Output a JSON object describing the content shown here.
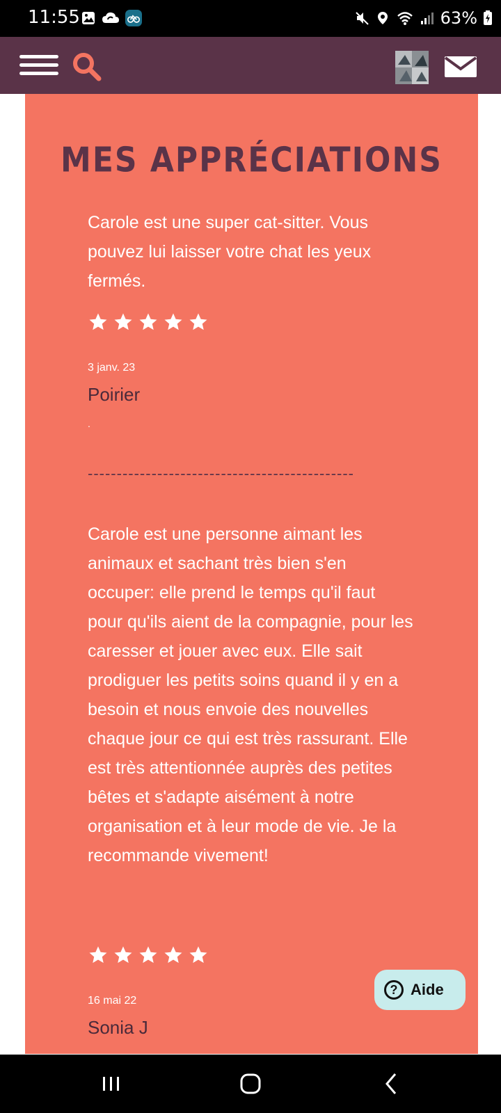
{
  "status_bar": {
    "time": "11:55",
    "battery": "63%",
    "icons": [
      "image-icon",
      "cloud-sync-icon",
      "bike-app-icon",
      "mute-icon",
      "location-icon",
      "wifi-icon",
      "signal-icon",
      "battery-icon"
    ]
  },
  "header": {
    "icons": [
      "menu-icon",
      "search-icon",
      "avatar",
      "mail-icon"
    ],
    "colors": {
      "background": "#5a3348",
      "search": "#f47461"
    }
  },
  "page": {
    "title": "MES APPRÉCIATIONS",
    "colors": {
      "panel": "#f47461",
      "title": "#5a3348"
    }
  },
  "reviews": [
    {
      "text": "Carole est une super cat-sitter. Vous pouvez lui laisser votre chat les yeux fermés.",
      "rating": 5,
      "date": "3 janv. 23",
      "author": "Poirier",
      "note": "."
    },
    {
      "text": "Carole est une personne aimant les animaux et sachant très bien s'en occuper: elle prend le temps qu'il faut pour qu'ils aient de la compagnie, pour les caresser et jouer avec eux. Elle sait prodiguer les petits soins quand il y en a besoin et nous envoie des nouvelles chaque jour ce qui est très rassurant. Elle est très attentionnée auprès des petites bêtes et s'adapte aisément à notre organisation et à leur mode de vie. Je la recommande vivement!",
      "rating": 5,
      "date": "16 mai 22",
      "author": "Sonia J"
    }
  ],
  "separator": "----------------------------------------------",
  "help": {
    "label": "Aide"
  },
  "nav_bar": {
    "buttons": [
      "recents-button",
      "home-button",
      "back-button"
    ]
  }
}
